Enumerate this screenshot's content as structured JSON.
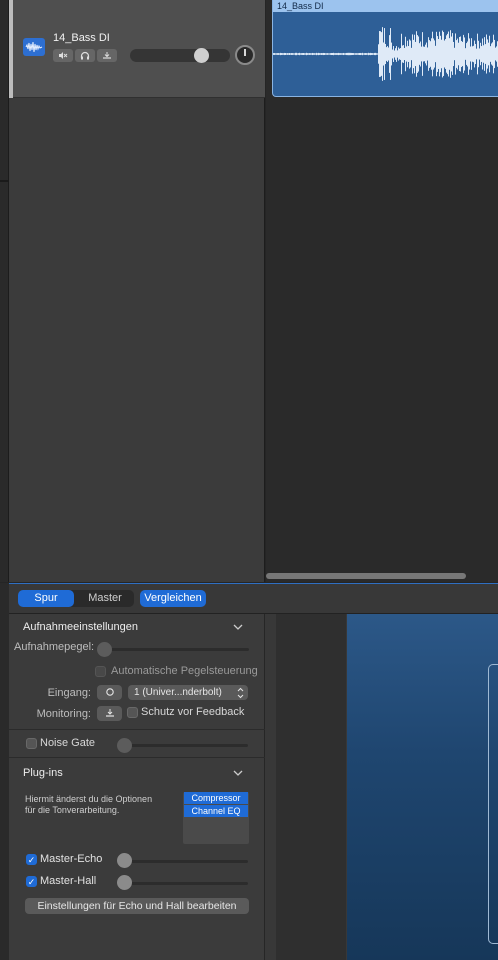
{
  "track": {
    "name": "14_Bass DI",
    "icon": "waveform-icon",
    "mute_icon": "speaker-mute-icon",
    "solo_icon": "headphones-icon",
    "record_icon": "input-monitor-icon",
    "volume": 0.72,
    "pan": 0
  },
  "region": {
    "name": "14_Bass DI"
  },
  "smart_controls": {
    "tabs": [
      "Spur",
      "Master"
    ],
    "active_tab": "Spur",
    "compare_label": "Vergleichen",
    "recording": {
      "title": "Aufnahmeeinstellungen",
      "level_label": "Aufnahmepegel:",
      "auto_level_label": "Automatische Pegelsteuerung",
      "input_label": "Eingang:",
      "input_value": "1  (Univer...nderbolt)",
      "monitoring_label": "Monitoring:",
      "feedback_label": "Schutz vor Feedback"
    },
    "noise_gate": {
      "label": "Noise Gate",
      "checked": false,
      "value": 0
    },
    "plugins": {
      "title": "Plug-ins",
      "hint": "Hiermit änderst du die Optionen für die Tonverarbeitung.",
      "items": [
        "Compressor",
        "Channel EQ"
      ],
      "master_echo": {
        "label": "Master-Echo",
        "checked": true,
        "value": 0
      },
      "master_hall": {
        "label": "Master-Hall",
        "checked": true,
        "value": 0
      },
      "edit_button": "Einstellungen für Echo und Hall bearbeiten"
    }
  },
  "colors": {
    "accent": "#1f6bd6",
    "region": "#2e5f97",
    "panel": "#3b3b3b"
  }
}
